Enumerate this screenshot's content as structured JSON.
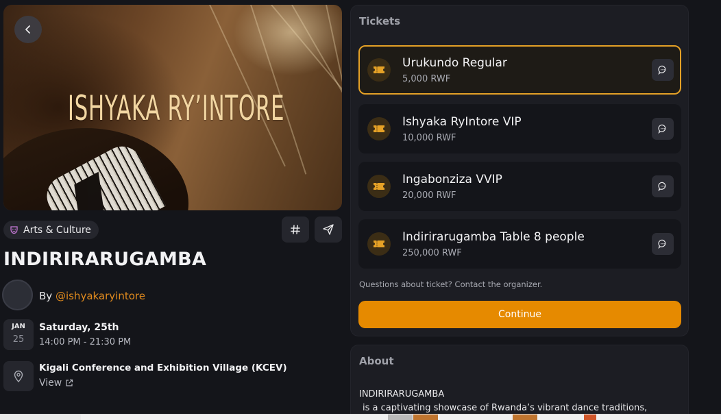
{
  "event": {
    "banner_text": "ISHYAKA RY’INTORE",
    "category": "Arts & Culture",
    "title": "INDIRIRARUGAMBA",
    "organizer_prefix": "By",
    "organizer_handle": "@ishyakaryintore",
    "date": {
      "month": "JAN",
      "day": "25",
      "label": "Saturday, 25th",
      "time": "14:00 PM - 21:30 PM"
    },
    "location": {
      "name": "Kigali Conference and Exhibition Village (KCEV)",
      "view_label": "View"
    }
  },
  "tickets": {
    "heading": "Tickets",
    "items": [
      {
        "name": "Urukundo Regular",
        "price": "5,000 RWF",
        "selected": true
      },
      {
        "name": "Ishyaka RyIntore VIP",
        "price": "10,000 RWF",
        "selected": false
      },
      {
        "name": "Ingabonziza VVIP",
        "price": "20,000 RWF",
        "selected": false
      },
      {
        "name": "Indirirarugamba Table 8 people",
        "price": "250,000 RWF",
        "selected": false
      }
    ],
    "questions_text": "Questions about ticket? Contact the organizer.",
    "continue_label": "Continue"
  },
  "about": {
    "heading": "About",
    "title_line": "INDIRIRARUGAMBA",
    "body_line": "is a captivating showcase of Rwanda’s vibrant dance traditions,"
  },
  "icons": {
    "back": "chevron-left-icon",
    "category": "theater-mask-icon",
    "hashtag": "hash-icon",
    "share": "send-icon",
    "location": "map-pin-icon",
    "external": "external-link-icon",
    "ticket": "ticket-icon",
    "chat": "chat-bubble-icon"
  },
  "colors": {
    "accent": "#e68a00",
    "selected_border": "#e5a126",
    "handle": "#e08a1e",
    "background": "#14151a",
    "card": "#1c1d23"
  }
}
